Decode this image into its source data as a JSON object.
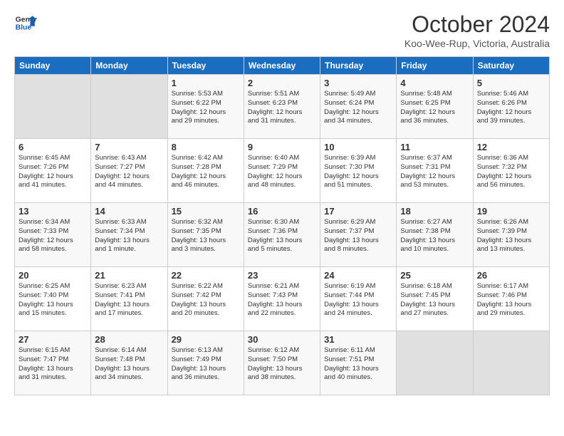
{
  "header": {
    "logo_line1": "General",
    "logo_line2": "Blue",
    "month": "October 2024",
    "location": "Koo-Wee-Rup, Victoria, Australia"
  },
  "columns": [
    "Sunday",
    "Monday",
    "Tuesday",
    "Wednesday",
    "Thursday",
    "Friday",
    "Saturday"
  ],
  "weeks": [
    [
      {
        "day": "",
        "info": ""
      },
      {
        "day": "",
        "info": ""
      },
      {
        "day": "1",
        "info": "Sunrise: 5:53 AM\nSunset: 6:22 PM\nDaylight: 12 hours\nand 29 minutes."
      },
      {
        "day": "2",
        "info": "Sunrise: 5:51 AM\nSunset: 6:23 PM\nDaylight: 12 hours\nand 31 minutes."
      },
      {
        "day": "3",
        "info": "Sunrise: 5:49 AM\nSunset: 6:24 PM\nDaylight: 12 hours\nand 34 minutes."
      },
      {
        "day": "4",
        "info": "Sunrise: 5:48 AM\nSunset: 6:25 PM\nDaylight: 12 hours\nand 36 minutes."
      },
      {
        "day": "5",
        "info": "Sunrise: 5:46 AM\nSunset: 6:26 PM\nDaylight: 12 hours\nand 39 minutes."
      }
    ],
    [
      {
        "day": "6",
        "info": "Sunrise: 6:45 AM\nSunset: 7:26 PM\nDaylight: 12 hours\nand 41 minutes."
      },
      {
        "day": "7",
        "info": "Sunrise: 6:43 AM\nSunset: 7:27 PM\nDaylight: 12 hours\nand 44 minutes."
      },
      {
        "day": "8",
        "info": "Sunrise: 6:42 AM\nSunset: 7:28 PM\nDaylight: 12 hours\nand 46 minutes."
      },
      {
        "day": "9",
        "info": "Sunrise: 6:40 AM\nSunset: 7:29 PM\nDaylight: 12 hours\nand 48 minutes."
      },
      {
        "day": "10",
        "info": "Sunrise: 6:39 AM\nSunset: 7:30 PM\nDaylight: 12 hours\nand 51 minutes."
      },
      {
        "day": "11",
        "info": "Sunrise: 6:37 AM\nSunset: 7:31 PM\nDaylight: 12 hours\nand 53 minutes."
      },
      {
        "day": "12",
        "info": "Sunrise: 6:36 AM\nSunset: 7:32 PM\nDaylight: 12 hours\nand 56 minutes."
      }
    ],
    [
      {
        "day": "13",
        "info": "Sunrise: 6:34 AM\nSunset: 7:33 PM\nDaylight: 12 hours\nand 58 minutes."
      },
      {
        "day": "14",
        "info": "Sunrise: 6:33 AM\nSunset: 7:34 PM\nDaylight: 13 hours\nand 1 minute."
      },
      {
        "day": "15",
        "info": "Sunrise: 6:32 AM\nSunset: 7:35 PM\nDaylight: 13 hours\nand 3 minutes."
      },
      {
        "day": "16",
        "info": "Sunrise: 6:30 AM\nSunset: 7:36 PM\nDaylight: 13 hours\nand 5 minutes."
      },
      {
        "day": "17",
        "info": "Sunrise: 6:29 AM\nSunset: 7:37 PM\nDaylight: 13 hours\nand 8 minutes."
      },
      {
        "day": "18",
        "info": "Sunrise: 6:27 AM\nSunset: 7:38 PM\nDaylight: 13 hours\nand 10 minutes."
      },
      {
        "day": "19",
        "info": "Sunrise: 6:26 AM\nSunset: 7:39 PM\nDaylight: 13 hours\nand 13 minutes."
      }
    ],
    [
      {
        "day": "20",
        "info": "Sunrise: 6:25 AM\nSunset: 7:40 PM\nDaylight: 13 hours\nand 15 minutes."
      },
      {
        "day": "21",
        "info": "Sunrise: 6:23 AM\nSunset: 7:41 PM\nDaylight: 13 hours\nand 17 minutes."
      },
      {
        "day": "22",
        "info": "Sunrise: 6:22 AM\nSunset: 7:42 PM\nDaylight: 13 hours\nand 20 minutes."
      },
      {
        "day": "23",
        "info": "Sunrise: 6:21 AM\nSunset: 7:43 PM\nDaylight: 13 hours\nand 22 minutes."
      },
      {
        "day": "24",
        "info": "Sunrise: 6:19 AM\nSunset: 7:44 PM\nDaylight: 13 hours\nand 24 minutes."
      },
      {
        "day": "25",
        "info": "Sunrise: 6:18 AM\nSunset: 7:45 PM\nDaylight: 13 hours\nand 27 minutes."
      },
      {
        "day": "26",
        "info": "Sunrise: 6:17 AM\nSunset: 7:46 PM\nDaylight: 13 hours\nand 29 minutes."
      }
    ],
    [
      {
        "day": "27",
        "info": "Sunrise: 6:15 AM\nSunset: 7:47 PM\nDaylight: 13 hours\nand 31 minutes."
      },
      {
        "day": "28",
        "info": "Sunrise: 6:14 AM\nSunset: 7:48 PM\nDaylight: 13 hours\nand 34 minutes."
      },
      {
        "day": "29",
        "info": "Sunrise: 6:13 AM\nSunset: 7:49 PM\nDaylight: 13 hours\nand 36 minutes."
      },
      {
        "day": "30",
        "info": "Sunrise: 6:12 AM\nSunset: 7:50 PM\nDaylight: 13 hours\nand 38 minutes."
      },
      {
        "day": "31",
        "info": "Sunrise: 6:11 AM\nSunset: 7:51 PM\nDaylight: 13 hours\nand 40 minutes."
      },
      {
        "day": "",
        "info": ""
      },
      {
        "day": "",
        "info": ""
      }
    ]
  ]
}
